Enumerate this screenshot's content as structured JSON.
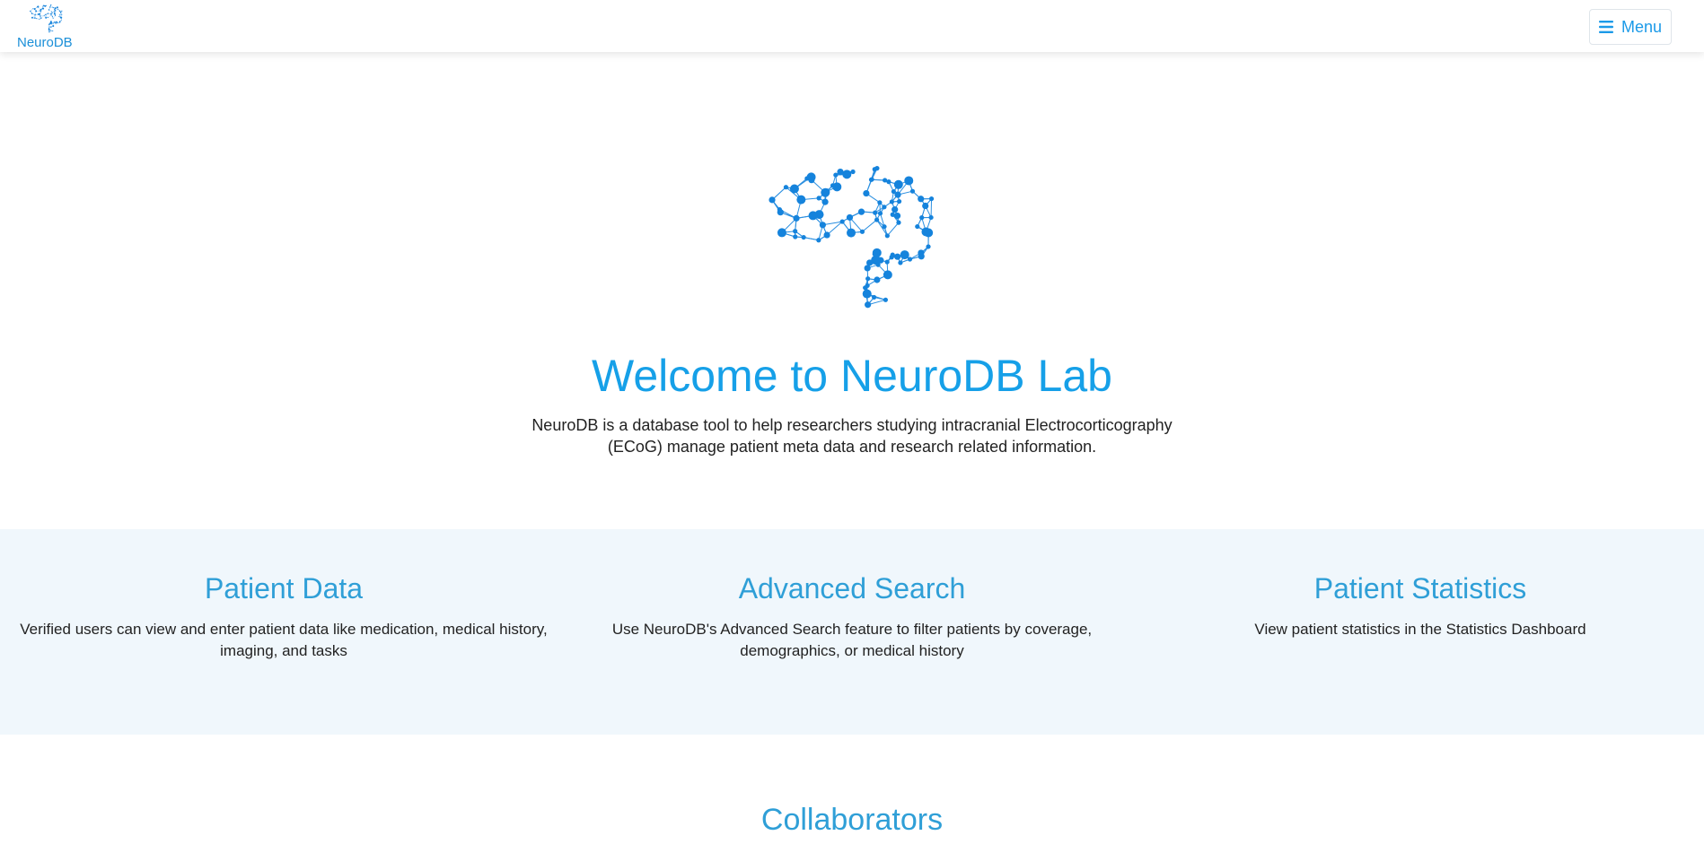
{
  "colors": {
    "accent": "#1b9ae8",
    "title": "#16a0e8",
    "section_heading": "#2f9fd7",
    "features_bg": "#f0f7fc"
  },
  "navbar": {
    "brand_label": "NeuroDB",
    "brand_icon": "brain-network-icon",
    "menu_icon": "hamburger-icon",
    "menu_label": "Menu"
  },
  "hero": {
    "image": "brain-network-illustration",
    "title": "Welcome to NeuroDB Lab",
    "description": "NeuroDB is a database tool to help researchers studying intracranial Electrocorticography (ECoG) manage patient meta data and research related information."
  },
  "features": [
    {
      "title": "Patient Data",
      "description": "Verified users can view and enter patient data like medication, medical history, imaging, and tasks"
    },
    {
      "title": "Advanced Search",
      "description": "Use NeuroDB's Advanced Search feature to filter patients by coverage, demographics, or medical history"
    },
    {
      "title": "Patient Statistics",
      "description": "View patient statistics in the Statistics Dashboard"
    }
  ],
  "collaborators": {
    "heading": "Collaborators"
  }
}
